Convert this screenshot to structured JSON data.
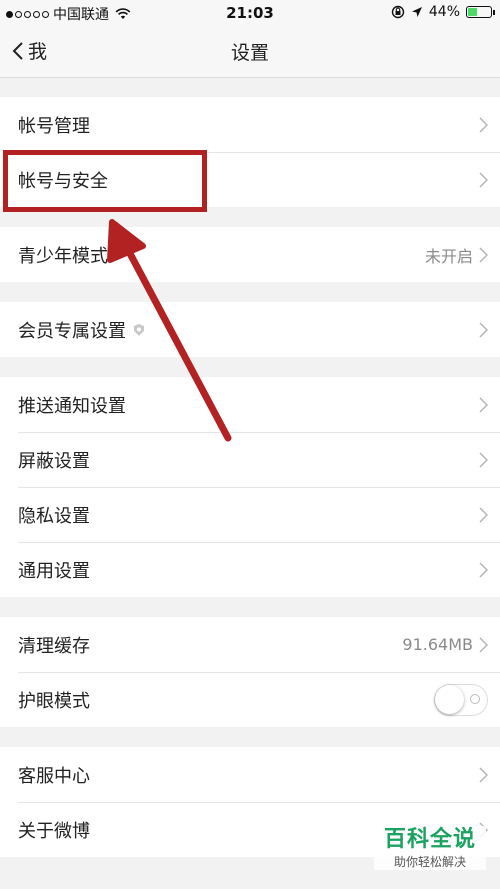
{
  "status_bar": {
    "carrier": "中国联通",
    "time": "21:03",
    "battery_percent": "44%",
    "battery_level": 0.44,
    "signal_bars_filled": 1,
    "signal_bars_total": 5
  },
  "nav": {
    "back_label": "我",
    "title": "设置"
  },
  "groups": [
    {
      "rows": [
        {
          "label": "帐号管理"
        },
        {
          "label": "帐号与安全"
        }
      ]
    },
    {
      "rows": [
        {
          "label": "青少年模式",
          "value": "未开启"
        }
      ]
    },
    {
      "rows": [
        {
          "label": "会员专属设置"
        }
      ]
    },
    {
      "rows": [
        {
          "label": "推送通知设置"
        },
        {
          "label": "屏蔽设置"
        },
        {
          "label": "隐私设置"
        },
        {
          "label": "通用设置"
        }
      ]
    },
    {
      "rows": [
        {
          "label": "清理缓存",
          "value": "91.64MB"
        },
        {
          "label": "护眼模式",
          "toggle_on": false
        }
      ]
    },
    {
      "rows": [
        {
          "label": "客服中心"
        },
        {
          "label": "关于微博"
        }
      ]
    }
  ],
  "watermark": {
    "title": "百科全说",
    "subtitle": "助你轻松解决"
  },
  "colors": {
    "annotation_red": "#b22222",
    "watermark_green": "#1aa260",
    "battery_green": "#4cd964"
  }
}
